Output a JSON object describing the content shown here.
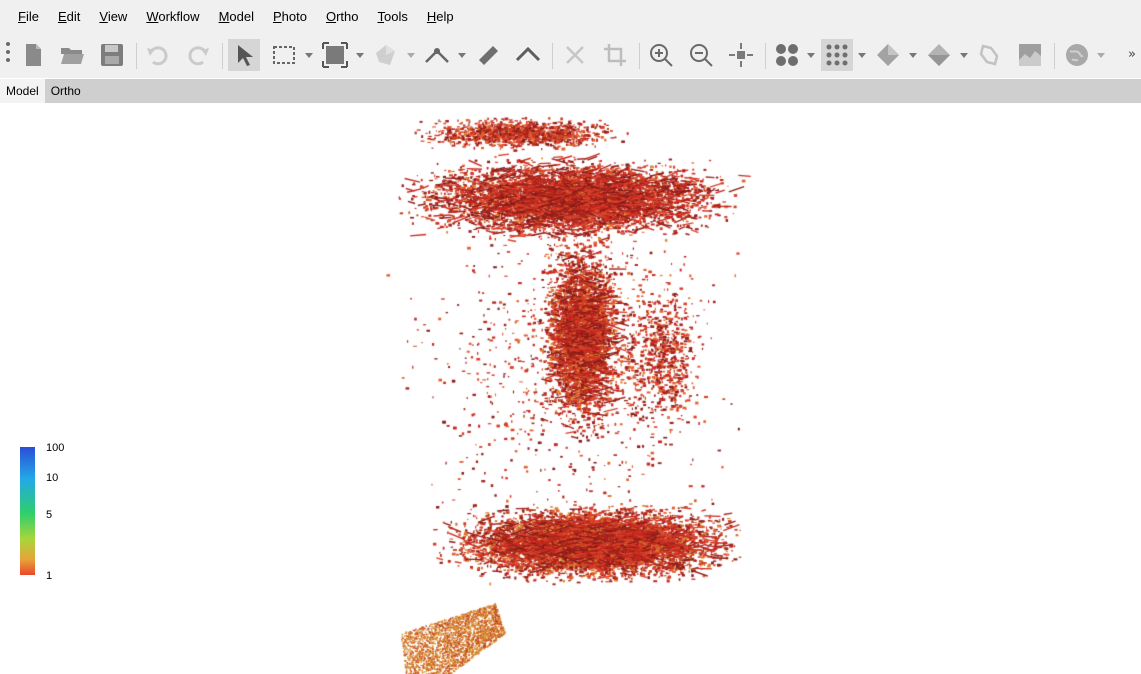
{
  "menu": [
    {
      "key": "F",
      "rest": "ile"
    },
    {
      "key": "E",
      "rest": "dit"
    },
    {
      "key": "V",
      "rest": "iew"
    },
    {
      "key": "W",
      "rest": "orkflow"
    },
    {
      "key": "M",
      "rest": "odel"
    },
    {
      "key": "P",
      "rest": "hoto"
    },
    {
      "key": "O",
      "rest": "rtho"
    },
    {
      "key": "T",
      "rest": "ools"
    },
    {
      "key": "H",
      "rest": "elp"
    }
  ],
  "toolbar": {
    "buttons": [
      "new-document-icon",
      "open-folder-icon",
      "save-icon",
      "undo-icon",
      "redo-icon",
      "navigation-pointer-icon",
      "rectangle-selection-icon",
      "resize-region-icon",
      "rotate-object-icon",
      "draw-polyline-icon",
      "ruler-icon",
      "draw-polygon-icon",
      "delete-icon",
      "crop-icon",
      "zoom-in-icon",
      "zoom-out-icon",
      "reset-view-icon",
      "show-cameras-icon",
      "show-points-icon",
      "show-shaded-model-icon",
      "show-solid-model-icon",
      "show-tiled-model-icon",
      "show-dem-icon",
      "show-globe-icon"
    ],
    "overflow_glyph": "»"
  },
  "tabs": [
    {
      "label": "Model",
      "selected": true
    },
    {
      "label": "Ortho",
      "selected": false
    }
  ],
  "legend": {
    "labels": [
      "100",
      "10",
      "5",
      "1"
    ],
    "colors": [
      "#2b4ed8",
      "#22a9e6",
      "#2fcf6a",
      "#a8d63a",
      "#e9a238",
      "#e8472b"
    ]
  },
  "point_cloud": {
    "palette": [
      "#c8281e",
      "#a5231c",
      "#d9402a",
      "#8a1c18",
      "#e0622e",
      "#d88a2c",
      "#c2451f"
    ]
  }
}
